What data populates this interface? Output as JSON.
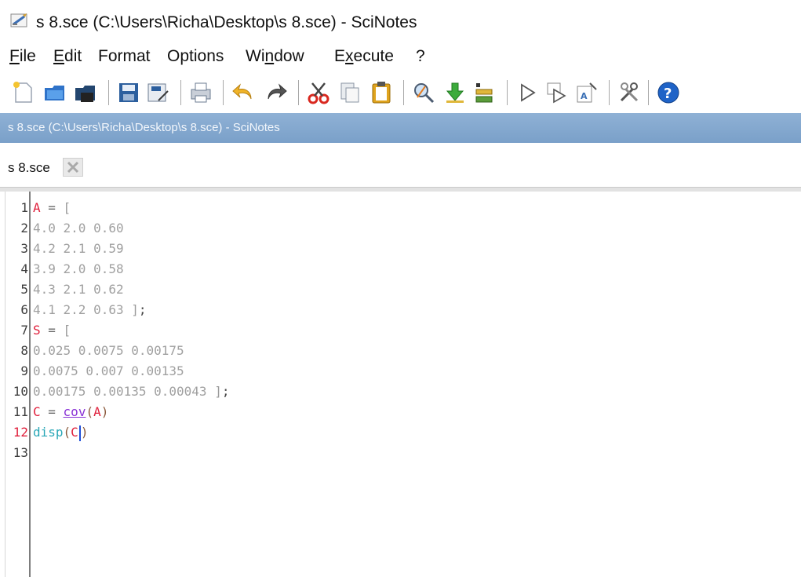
{
  "window": {
    "title": "s 8.sce (C:\\Users\\Richa\\Desktop\\s 8.sce) - SciNotes"
  },
  "menu": [
    {
      "pre": "",
      "u": "F",
      "post": "ile"
    },
    {
      "pre": "",
      "u": "E",
      "post": "dit"
    },
    {
      "pre": "Format",
      "u": "",
      "post": ""
    },
    {
      "pre": "Options",
      "u": "",
      "post": ""
    },
    {
      "pre": "Wi",
      "u": "n",
      "post": "dow"
    },
    {
      "pre": "E",
      "u": "x",
      "post": "ecute"
    },
    {
      "pre": "?",
      "u": "",
      "post": ""
    }
  ],
  "toolbar_icons": [
    "new-file-icon",
    "open-file-icon",
    "open-recent-icon",
    "save-icon",
    "save-as-icon",
    "print-icon",
    "undo-icon",
    "redo-icon",
    "cut-icon",
    "copy-icon",
    "paste-icon",
    "find-replace-icon",
    "load-into-scilab-icon",
    "execute-file-icon",
    "run-icon",
    "run-selection-icon",
    "format-code-icon",
    "preferences-icon",
    "help-icon"
  ],
  "pathbar": {
    "text": "s 8.sce (C:\\Users\\Richa\\Desktop\\s 8.sce) - SciNotes"
  },
  "tab": {
    "label": "s 8.sce"
  },
  "editor": {
    "line_numbers": [
      "1",
      "2",
      "3",
      "4",
      "5",
      "6",
      "7",
      "8",
      "9",
      "10",
      "11",
      "12",
      "13"
    ],
    "current_line": 12,
    "lines": [
      [
        {
          "t": "A",
          "c": "var"
        },
        {
          "t": " = ",
          "c": "op"
        },
        {
          "t": "[",
          "c": "brk"
        }
      ],
      [
        {
          "t": "4.0 2.0 0.60",
          "c": "num"
        }
      ],
      [
        {
          "t": "4.2 2.1 0.59",
          "c": "num"
        }
      ],
      [
        {
          "t": "3.9 2.0 0.58",
          "c": "num"
        }
      ],
      [
        {
          "t": "4.3 2.1 0.62",
          "c": "num"
        }
      ],
      [
        {
          "t": "4.1 2.2 0.63 ",
          "c": "num"
        },
        {
          "t": "]",
          "c": "brk"
        },
        {
          "t": ";",
          "c": "punct"
        }
      ],
      [
        {
          "t": "S",
          "c": "var"
        },
        {
          "t": " = ",
          "c": "op"
        },
        {
          "t": "[",
          "c": "brk"
        }
      ],
      [
        {
          "t": "0.025 0.0075 0.00175",
          "c": "num"
        }
      ],
      [
        {
          "t": "0.0075 0.007 0.00135",
          "c": "num"
        }
      ],
      [
        {
          "t": "0.00175 0.00135 0.00043 ",
          "c": "num"
        },
        {
          "t": "]",
          "c": "brk"
        },
        {
          "t": ";",
          "c": "punct"
        }
      ],
      [
        {
          "t": "C",
          "c": "var"
        },
        {
          "t": " = ",
          "c": "op"
        },
        {
          "t": "cov",
          "c": "func-cov"
        },
        {
          "t": "(",
          "c": "paren"
        },
        {
          "t": "A",
          "c": "var"
        },
        {
          "t": ")",
          "c": "paren"
        }
      ],
      [
        {
          "t": "disp",
          "c": "func-disp"
        },
        {
          "t": "(",
          "c": "paren"
        },
        {
          "t": "C",
          "c": "var"
        },
        {
          "t": "|caret|",
          "c": "caret"
        },
        {
          "t": ")",
          "c": "paren"
        }
      ],
      []
    ]
  },
  "colors": {
    "pathbar": "#7aa0c9",
    "variable": "#e0203c",
    "number": "#a0a0a0",
    "function_cov": "#8a33d6",
    "function_disp": "#29a7b7",
    "current_line_number": "#e0203c"
  }
}
